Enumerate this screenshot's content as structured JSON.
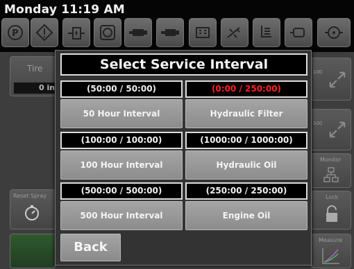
{
  "clock": "Monday 11:19 AM",
  "top_icons": [
    "parking-brake-icon",
    "warning-icon",
    "fuel-filter-icon",
    "air-filter-icon",
    "engine-temp-icon",
    "engine-oil-pressure-icon",
    "battery-charge-icon",
    "hydraulic-temp-icon",
    "transmission-icon",
    "engine-check-icon",
    "engine-warning-icon"
  ],
  "background": {
    "tire_label": "Tire",
    "tire_value": "0 in",
    "reset_spray_label": "Reset Spray",
    "monitor_label": "Monitor",
    "lock_label": "Lock",
    "measure_label": "Measure",
    "gauge_value_a": "100",
    "gauge_value_b": "100"
  },
  "dialog": {
    "title": "Select Service Interval",
    "rows": [
      {
        "left_time": "(50:00 / 50:00)",
        "left_label": "50 Hour Interval",
        "right_time": "(0:00 / 250:00)",
        "right_label": "Hydraulic Filter",
        "right_time_color": "#ff2020"
      },
      {
        "left_time": "(100:00 / 100:00)",
        "left_label": "100 Hour Interval",
        "right_time": "(1000:00 / 1000:00)",
        "right_label": "Hydraulic Oil"
      },
      {
        "left_time": "(500:00 / 500:00)",
        "left_label": "500 Hour Interval",
        "right_time": "(250:00 / 250:00)",
        "right_label": "Engine Oil"
      }
    ],
    "back_label": "Back"
  }
}
